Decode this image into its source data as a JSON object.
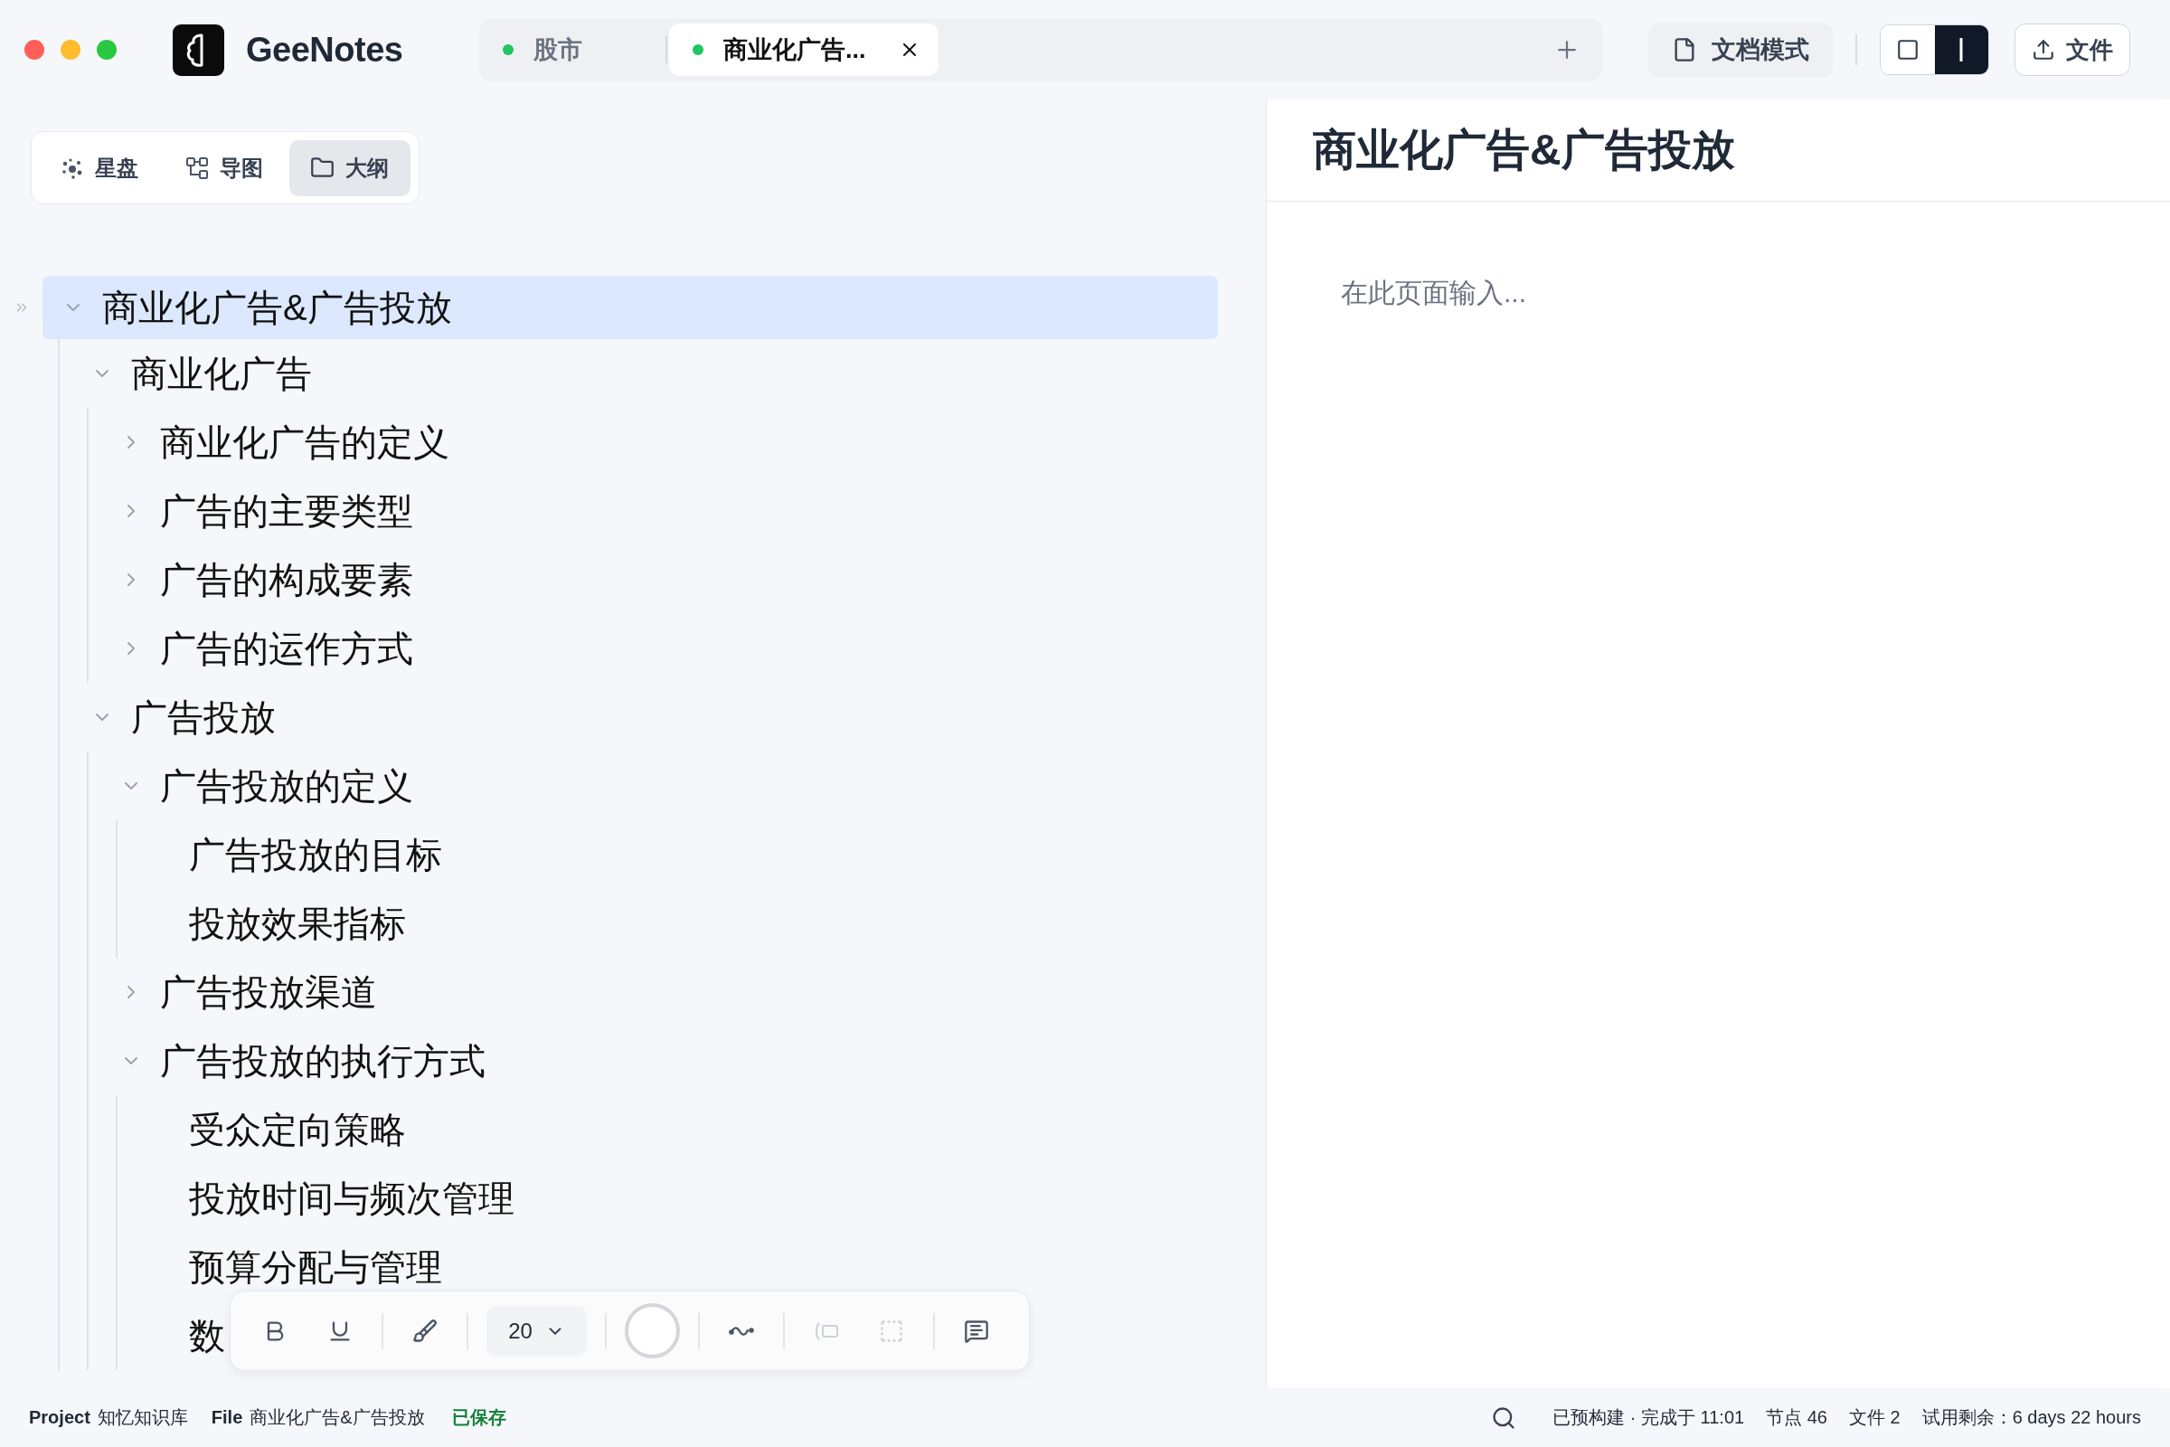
{
  "app": {
    "name": "GeeNotes"
  },
  "tabs": [
    {
      "label": "股市",
      "selected": false
    },
    {
      "label": "商业化广告...",
      "selected": true
    }
  ],
  "header_actions": {
    "doc_mode": "文档模式",
    "layout_toggle": [
      {
        "kind": "single",
        "selected": false
      },
      {
        "kind": "split",
        "selected": true
      }
    ],
    "file_button": "文件"
  },
  "view_switcher": [
    {
      "label": "星盘",
      "kind": "constellation",
      "selected": false
    },
    {
      "label": "导图",
      "kind": "mindmap",
      "selected": false
    },
    {
      "label": "大纲",
      "kind": "outline",
      "selected": true
    }
  ],
  "outline": [
    {
      "label": "商业化广告&广告投放",
      "selected": true,
      "expanded": true,
      "children": [
        {
          "label": "商业化广告",
          "selected": false,
          "expanded": true,
          "children": [
            {
              "label": "商业化广告的定义",
              "selected": false,
              "expanded": false
            },
            {
              "label": "广告的主要类型",
              "selected": false,
              "expanded": false
            },
            {
              "label": "广告的构成要素",
              "selected": false,
              "expanded": false
            },
            {
              "label": "广告的运作方式",
              "selected": false,
              "expanded": false
            }
          ]
        },
        {
          "label": "广告投放",
          "selected": false,
          "expanded": true,
          "children": [
            {
              "label": "广告投放的定义",
              "selected": false,
              "expanded": true,
              "children": [
                {
                  "label": "广告投放的目标",
                  "selected": false
                },
                {
                  "label": "投放效果指标",
                  "selected": false
                }
              ]
            },
            {
              "label": "广告投放渠道",
              "selected": false,
              "expanded": false
            },
            {
              "label": "广告投放的执行方式",
              "selected": false,
              "expanded": true,
              "children": [
                {
                  "label": "受众定向策略",
                  "selected": false
                },
                {
                  "label": "投放时间与频次管理",
                  "selected": false
                },
                {
                  "label": "预算分配与管理",
                  "selected": false
                },
                {
                  "label": "数",
                  "selected": false
                }
              ]
            }
          ]
        }
      ]
    }
  ],
  "format_toolbar": {
    "groups": [
      [
        {
          "kind": "bold",
          "disabled": false
        },
        {
          "kind": "underline",
          "disabled": false
        }
      ],
      [
        {
          "kind": "brush",
          "disabled": false
        }
      ],
      [
        {
          "kind": "font_size",
          "value": "20"
        }
      ],
      [
        {
          "kind": "color",
          "color": "#ffffff"
        }
      ],
      [
        {
          "kind": "curve",
          "disabled": false
        }
      ],
      [
        {
          "kind": "wrap",
          "disabled": true
        },
        {
          "kind": "frame",
          "disabled": true
        }
      ],
      [
        {
          "kind": "comment",
          "disabled": false
        }
      ]
    ]
  },
  "editor": {
    "title": "商业化广告&广告投放",
    "placeholder": "在此页面输入..."
  },
  "status_bar": {
    "project": {
      "label": "Project",
      "value": "知忆知识库"
    },
    "file": {
      "label": "File",
      "value": "商业化广告&广告投放"
    },
    "save_state": "已保存",
    "build": "已预构建 · 完成于 11:01",
    "nodes": "节点 46",
    "files": "文件 2",
    "trial": "试用剩余：6 days 22 hours"
  }
}
